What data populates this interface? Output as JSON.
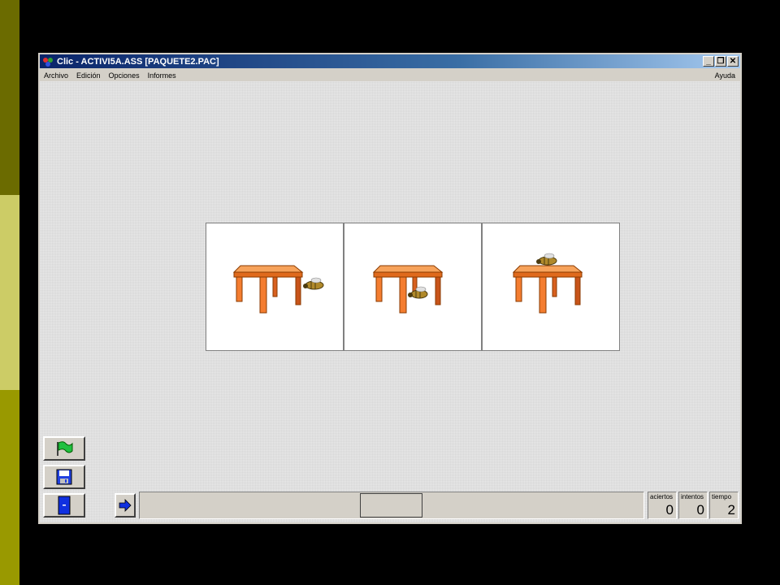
{
  "window": {
    "title": "Clic - ACTIVI5A.ASS [PAQUETE2.PAC]"
  },
  "menu": {
    "items": [
      "Archivo",
      "Edición",
      "Opciones",
      "Informes"
    ],
    "help": "Ayuda"
  },
  "cards": [
    {
      "name": "card-bee-beside-table"
    },
    {
      "name": "card-bee-under-table"
    },
    {
      "name": "card-bee-on-table"
    }
  ],
  "side_buttons": [
    {
      "name": "start-flag-button",
      "icon": "green-flag-icon"
    },
    {
      "name": "save-button",
      "icon": "floppy-disk-icon"
    },
    {
      "name": "exit-button",
      "icon": "door-icon"
    }
  ],
  "next_button": {
    "icon": "blue-arrow-right-icon"
  },
  "counters": [
    {
      "label": "aciertos",
      "value": "0"
    },
    {
      "label": "intentos",
      "value": "0"
    },
    {
      "label": "tiempo",
      "value": "2"
    }
  ],
  "colors": {
    "title_bar": "#0a246a",
    "table": "#f47d30",
    "button_face": "#d4d0c8",
    "work_area": "#d6d6d6"
  }
}
